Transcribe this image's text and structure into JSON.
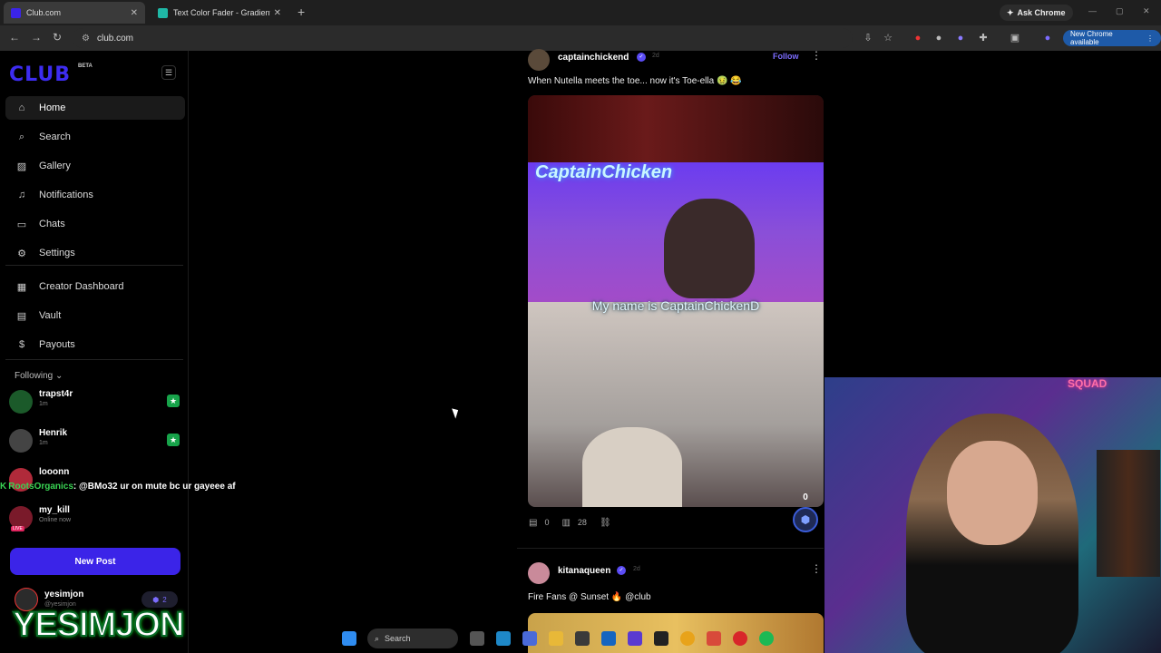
{
  "browser": {
    "tabs": [
      {
        "title": "Club.com",
        "favicon_color": "#3b24e8"
      },
      {
        "title": "Text Color Fader - Gradient / ra",
        "favicon_color": "#1fb8a6"
      }
    ],
    "ask_chrome": "Ask Chrome",
    "url": "club.com",
    "update_label": "New Chrome available"
  },
  "sidebar": {
    "logo": "CLUB",
    "beta": "BETA",
    "nav": [
      {
        "label": "Home",
        "icon": "home-icon",
        "active": true
      },
      {
        "label": "Search",
        "icon": "search-icon"
      },
      {
        "label": "Gallery",
        "icon": "gallery-icon"
      },
      {
        "label": "Notifications",
        "icon": "bell-icon"
      },
      {
        "label": "Chats",
        "icon": "chat-icon"
      },
      {
        "label": "Settings",
        "icon": "gear-icon"
      }
    ],
    "nav2": [
      {
        "label": "Creator Dashboard",
        "icon": "dashboard-icon"
      },
      {
        "label": "Vault",
        "icon": "vault-icon"
      },
      {
        "label": "Payouts",
        "icon": "dollar-icon"
      }
    ],
    "following_label": "Following",
    "following": [
      {
        "name": "trapst4r",
        "sub": "1m",
        "color": "#1b5a2a"
      },
      {
        "name": "Henrik",
        "sub": "1m",
        "color": "#444"
      },
      {
        "name": "looonn",
        "sub": "",
        "color": "#b02a3a"
      },
      {
        "name": "my_kill",
        "sub": "Online now",
        "color": "#7a1a2a",
        "live": "LIVE"
      }
    ],
    "new_post": "New Post",
    "profile": {
      "name": "yesimjon",
      "handle": "@yesimjon",
      "badge_count": "2"
    }
  },
  "overlay": {
    "chat_user": "RootsOrganics",
    "chat_message": ": @BMo32 ur on mute bc ur gayeee af",
    "stream_name": "YESIMJON"
  },
  "feed": {
    "post1": {
      "author": "captainchickend",
      "time": "2d",
      "follow": "Follow",
      "text": "When Nutella meets the toe... now it's Toe-ella 🤢 😂",
      "video_neon": "CaptainChicken",
      "video_caption": "My name is CaptainChickenD",
      "comments": "0",
      "views": "28",
      "tip_count": "0"
    },
    "post2": {
      "author": "kitanaqueen",
      "time": "2d",
      "text": "Fire Fans @ Sunset 🔥 @club"
    }
  },
  "webcam": {
    "sign": "SQUAD"
  },
  "taskbar": {
    "search": "Search"
  }
}
